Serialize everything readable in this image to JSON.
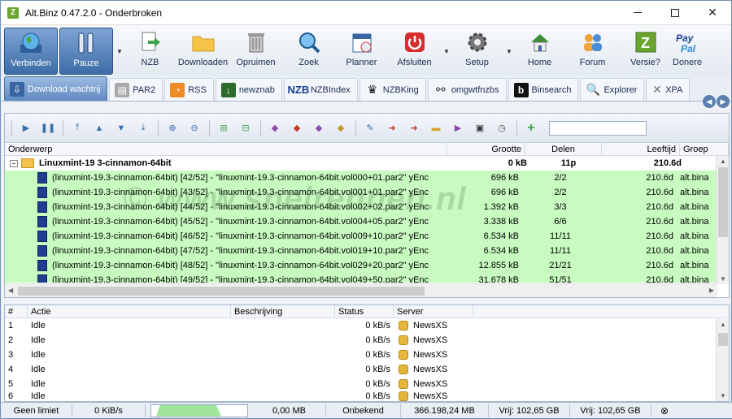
{
  "window": {
    "title": "Alt.Binz 0.47.2.0 - Onderbroken",
    "app_icon": "Z"
  },
  "toolbar": {
    "buttons": [
      {
        "label": "Verbinden",
        "icon": "globe-network-icon",
        "active": true
      },
      {
        "label": "Pauze",
        "icon": "pause-icon",
        "active": true
      },
      {
        "label": "NZB",
        "icon": "nzb-arrow-icon"
      },
      {
        "label": "Downloaden",
        "icon": "folder-icon"
      },
      {
        "label": "Opruimen",
        "icon": "trash-icon"
      },
      {
        "label": "Zoek",
        "icon": "magnifier-icon"
      },
      {
        "label": "Planner",
        "icon": "calendar-icon"
      },
      {
        "label": "Afsluiten",
        "icon": "power-icon"
      },
      {
        "label": "Setup",
        "icon": "gear-icon"
      },
      {
        "label": "Home",
        "icon": "house-icon"
      },
      {
        "label": "Forum",
        "icon": "people-icon"
      },
      {
        "label": "Versie?",
        "icon": "z-logo-icon"
      },
      {
        "label": "Donere",
        "icon": "paypal-icon"
      }
    ]
  },
  "tabs": [
    {
      "label": "Download wachtrij",
      "active": true
    },
    {
      "label": "PAR2"
    },
    {
      "label": "RSS"
    },
    {
      "label": "newznab"
    },
    {
      "label": "NZBIndex"
    },
    {
      "label": "NZBKing"
    },
    {
      "label": "omgwtfnzbs"
    },
    {
      "label": "Binsearch"
    },
    {
      "label": "Explorer"
    },
    {
      "label": "XPA"
    }
  ],
  "queue": {
    "columns": [
      "Onderwerp",
      "Grootte",
      "Delen",
      "Leeftijd",
      "Groep"
    ],
    "group": {
      "name": "Linuxmint-19 3-cinnamon-64bit",
      "size": "0 kB",
      "parts": "11p",
      "age": "210.6d"
    },
    "rows": [
      {
        "subject": "(linuxmint-19.3-cinnamon-64bit) [42/52] - \"linuxmint-19.3-cinnamon-64bit.vol000+01.par2\" yEnc",
        "size": "696 kB",
        "parts": "2/2",
        "age": "210.6d",
        "group": "alt.bina"
      },
      {
        "subject": "(linuxmint-19.3-cinnamon-64bit) [43/52] - \"linuxmint-19.3-cinnamon-64bit.vol001+01.par2\" yEnc",
        "size": "696 kB",
        "parts": "2/2",
        "age": "210.6d",
        "group": "alt.bina"
      },
      {
        "subject": "(linuxmint-19.3-cinnamon-64bit) [44/52] - \"linuxmint-19.3-cinnamon-64bit.vol002+02.par2\" yEnc",
        "size": "1.392 kB",
        "parts": "3/3",
        "age": "210.6d",
        "group": "alt.bina"
      },
      {
        "subject": "(linuxmint-19.3-cinnamon-64bit) [45/52] - \"linuxmint-19.3-cinnamon-64bit.vol004+05.par2\" yEnc",
        "size": "3.338 kB",
        "parts": "6/6",
        "age": "210.6d",
        "group": "alt.bina"
      },
      {
        "subject": "(linuxmint-19.3-cinnamon-64bit) [46/52] - \"linuxmint-19.3-cinnamon-64bit.vol009+10.par2\" yEnc",
        "size": "6.534 kB",
        "parts": "11/11",
        "age": "210.6d",
        "group": "alt.bina"
      },
      {
        "subject": "(linuxmint-19.3-cinnamon-64bit) [47/52] - \"linuxmint-19.3-cinnamon-64bit.vol019+10.par2\" yEnc",
        "size": "6.534 kB",
        "parts": "11/11",
        "age": "210.6d",
        "group": "alt.bina"
      },
      {
        "subject": "(linuxmint-19.3-cinnamon-64bit) [48/52] - \"linuxmint-19.3-cinnamon-64bit.vol029+20.par2\" yEnc",
        "size": "12.855 kB",
        "parts": "21/21",
        "age": "210.6d",
        "group": "alt.bina"
      },
      {
        "subject": "(linuxmint-19.3-cinnamon-64bit) [49/52] - \"linuxmint-19.3-cinnamon-64bit.vol049+50.par2\" yEnc",
        "size": "31.678 kB",
        "parts": "51/51",
        "age": "210.6d",
        "group": "alt.bina"
      }
    ]
  },
  "watermark": "© www.snelrennen.nl",
  "connections": {
    "columns": [
      "#",
      "Actie",
      "Beschrijving",
      "Status",
      "Server"
    ],
    "rows": [
      {
        "n": "1",
        "action": "Idle",
        "status": "0 kB/s",
        "server": "NewsXS"
      },
      {
        "n": "2",
        "action": "Idle",
        "status": "0 kB/s",
        "server": "NewsXS"
      },
      {
        "n": "3",
        "action": "Idle",
        "status": "0 kB/s",
        "server": "NewsXS"
      },
      {
        "n": "4",
        "action": "Idle",
        "status": "0 kB/s",
        "server": "NewsXS"
      },
      {
        "n": "5",
        "action": "Idle",
        "status": "0 kB/s",
        "server": "NewsXS"
      },
      {
        "n": "6",
        "action": "Idle",
        "status": "0 kB/s",
        "server": "NewsXS"
      }
    ]
  },
  "statusbar": {
    "limit": "Geen limiet",
    "speed": "0 KiB/s",
    "downloaded": "0,00 MB",
    "eta": "Onbekend",
    "total": "366.198,24 MB",
    "free1": "Vrij: 102,65 GB",
    "free2": "Vrij: 102,65 GB"
  },
  "colors": {
    "selected_row": "#c8fbc0",
    "accent": "#3d6ca7"
  }
}
